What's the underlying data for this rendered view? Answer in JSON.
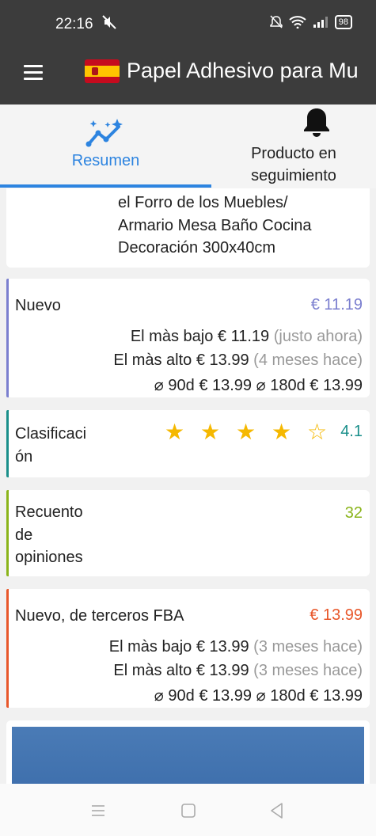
{
  "status": {
    "time": "22:16",
    "battery": "98"
  },
  "appbar": {
    "title": "Papel Adhesivo para Mu"
  },
  "tabs": [
    {
      "label": "Resumen"
    },
    {
      "label_line1": "Producto en",
      "label_line2": "seguimiento"
    }
  ],
  "product": {
    "title_lines": [
      "el Forro de los Muebles/",
      "Armario Mesa Baño Cocina",
      "Decoración 300x40cm"
    ]
  },
  "new": {
    "label": "Nuevo",
    "price": "€ 11.19",
    "lowest_label": "El màs bajo",
    "lowest_value": "€ 11.19",
    "lowest_when": "(justo ahora)",
    "highest_label": "El màs alto",
    "highest_value": "€ 13.99",
    "highest_when": "(4 meses hace)",
    "avg90_label": "⌀ 90d",
    "avg90_value": "€ 13.99",
    "avg180_label": "⌀ 180d",
    "avg180_value": "€ 13.99",
    "color": "#7b7fcf"
  },
  "rating": {
    "label_line1": "Clasificaci",
    "label_line2": "ón",
    "value": "4.1",
    "stars": 4,
    "color": "#1a8f8a"
  },
  "reviews": {
    "label_line1": "Recuento",
    "label_line2": "de",
    "label_line3": "opiniones",
    "value": "32",
    "color": "#8ab41a"
  },
  "fba": {
    "label": "Nuevo, de terceros FBA",
    "price": "€ 13.99",
    "lowest_label": "El màs bajo",
    "lowest_value": "€ 13.99",
    "lowest_when": "(3 meses hace)",
    "highest_label": "El màs alto",
    "highest_value": "€ 13.99",
    "highest_when": "(3 meses hace)",
    "avg90_label": "⌀ 90d",
    "avg90_value": "€ 13.99",
    "avg180_label": "⌀ 180d",
    "avg180_value": "€ 13.99",
    "color": "#e8572a"
  }
}
